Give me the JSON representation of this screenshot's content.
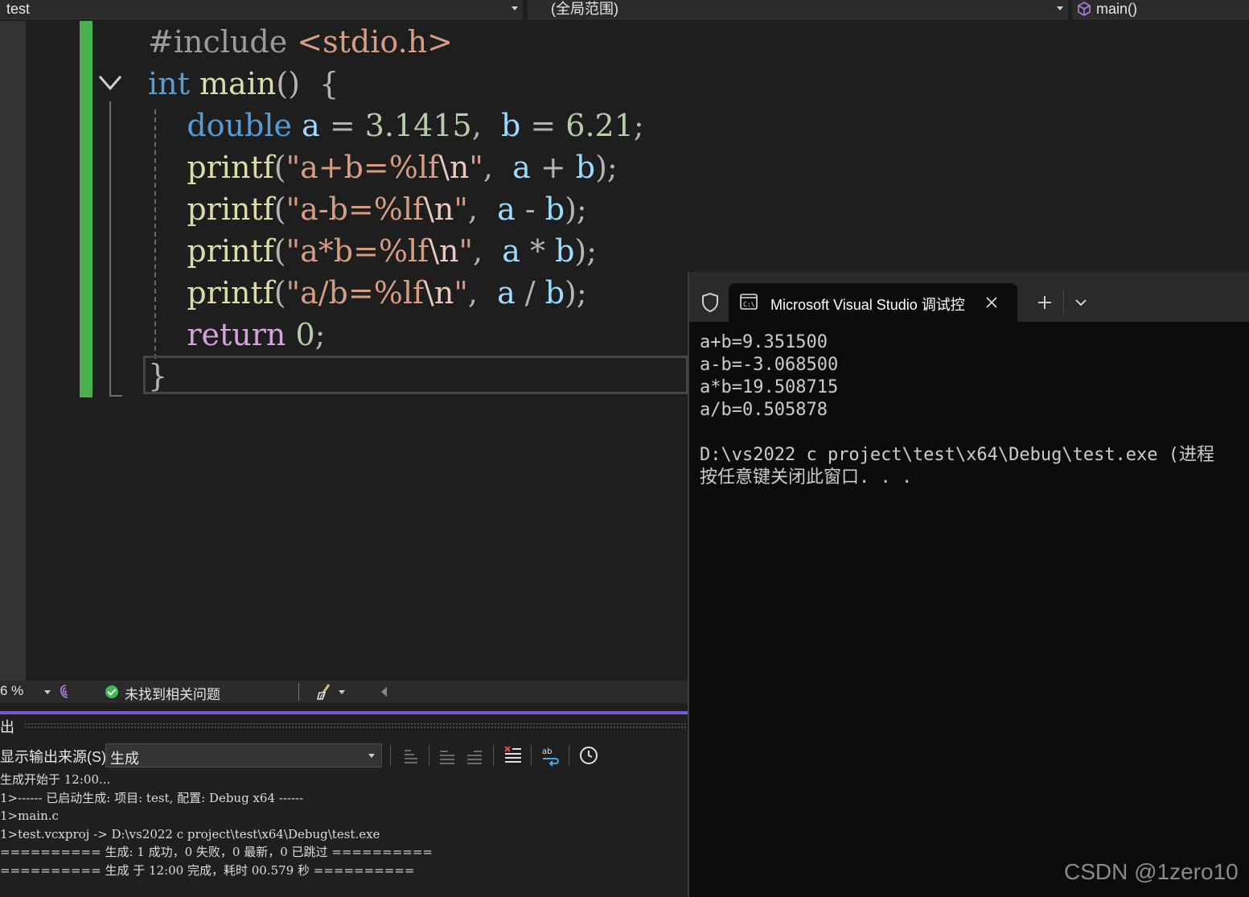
{
  "navbar": {
    "project": "test",
    "scope": "(全局范围)",
    "member": "main()"
  },
  "editor": {
    "lines": [
      {
        "tokens": [
          {
            "t": "#include ",
            "c": "pre"
          },
          {
            "t": "<stdio.h>",
            "c": "inc"
          }
        ]
      },
      {
        "tokens": [
          {
            "t": "int",
            "c": "kw"
          },
          {
            "t": " ",
            "c": ""
          },
          {
            "t": "main",
            "c": "fn"
          },
          {
            "t": "()  {",
            "c": "op"
          }
        ]
      },
      {
        "tokens": [
          {
            "t": "    ",
            "c": ""
          },
          {
            "t": "double",
            "c": "kw"
          },
          {
            "t": " ",
            "c": ""
          },
          {
            "t": "a",
            "c": "var"
          },
          {
            "t": " = ",
            "c": "op"
          },
          {
            "t": "3.1415",
            "c": "num"
          },
          {
            "t": ",  ",
            "c": "op"
          },
          {
            "t": "b",
            "c": "var"
          },
          {
            "t": " = ",
            "c": "op"
          },
          {
            "t": "6.21",
            "c": "num"
          },
          {
            "t": ";",
            "c": "op"
          }
        ]
      },
      {
        "tokens": [
          {
            "t": "    ",
            "c": ""
          },
          {
            "t": "printf",
            "c": "fn"
          },
          {
            "t": "(",
            "c": "op"
          },
          {
            "t": "\"a+b=%lf",
            "c": "str"
          },
          {
            "t": "\\n",
            "c": "esc"
          },
          {
            "t": "\"",
            "c": "str"
          },
          {
            "t": ",  ",
            "c": "op"
          },
          {
            "t": "a",
            "c": "var"
          },
          {
            "t": " + ",
            "c": "op"
          },
          {
            "t": "b",
            "c": "var"
          },
          {
            "t": ");",
            "c": "op"
          }
        ]
      },
      {
        "tokens": [
          {
            "t": "    ",
            "c": ""
          },
          {
            "t": "printf",
            "c": "fn"
          },
          {
            "t": "(",
            "c": "op"
          },
          {
            "t": "\"a-b=%lf",
            "c": "str"
          },
          {
            "t": "\\n",
            "c": "esc"
          },
          {
            "t": "\"",
            "c": "str"
          },
          {
            "t": ",  ",
            "c": "op"
          },
          {
            "t": "a",
            "c": "var"
          },
          {
            "t": " - ",
            "c": "op"
          },
          {
            "t": "b",
            "c": "var"
          },
          {
            "t": ");",
            "c": "op"
          }
        ]
      },
      {
        "tokens": [
          {
            "t": "    ",
            "c": ""
          },
          {
            "t": "printf",
            "c": "fn"
          },
          {
            "t": "(",
            "c": "op"
          },
          {
            "t": "\"a*b=%lf",
            "c": "str"
          },
          {
            "t": "\\n",
            "c": "esc"
          },
          {
            "t": "\"",
            "c": "str"
          },
          {
            "t": ",  ",
            "c": "op"
          },
          {
            "t": "a",
            "c": "var"
          },
          {
            "t": " * ",
            "c": "op"
          },
          {
            "t": "b",
            "c": "var"
          },
          {
            "t": ");",
            "c": "op"
          }
        ]
      },
      {
        "tokens": [
          {
            "t": "    ",
            "c": ""
          },
          {
            "t": "printf",
            "c": "fn"
          },
          {
            "t": "(",
            "c": "op"
          },
          {
            "t": "\"a/b=%lf",
            "c": "str"
          },
          {
            "t": "\\n",
            "c": "esc"
          },
          {
            "t": "\"",
            "c": "str"
          },
          {
            "t": ",  ",
            "c": "op"
          },
          {
            "t": "a",
            "c": "var"
          },
          {
            "t": " / ",
            "c": "op"
          },
          {
            "t": "b",
            "c": "var"
          },
          {
            "t": ");",
            "c": "op"
          }
        ]
      },
      {
        "tokens": [
          {
            "t": "    ",
            "c": ""
          },
          {
            "t": "return",
            "c": "ret"
          },
          {
            "t": " ",
            "c": ""
          },
          {
            "t": "0",
            "c": "num"
          },
          {
            "t": ";",
            "c": "op"
          }
        ]
      },
      {
        "tokens": [
          {
            "t": "}",
            "c": "op"
          }
        ]
      }
    ]
  },
  "status": {
    "zoom": "6 %",
    "issues": "未找到相关问题"
  },
  "output": {
    "title": "出",
    "source_label": "显示输出来源(S):",
    "source_value": "生成",
    "lines": [
      "生成开始于 12:00...",
      "1>------ 已启动生成: 项目: test, 配置: Debug x64 ------",
      "1>main.c",
      "1>test.vcxproj -> D:\\vs2022 c project\\test\\x64\\Debug\\test.exe",
      "========== 生成: 1 成功，0 失败，0 最新，0 已跳过 ==========",
      "========== 生成 于 12:00 完成，耗时 00.579 秒 =========="
    ]
  },
  "console": {
    "tab_title": "Microsoft Visual Studio 调试控",
    "lines": [
      "a+b=9.351500",
      "a-b=-3.068500",
      "a*b=19.508715",
      "a/b=0.505878",
      "",
      "D:\\vs2022 c project\\test\\x64\\Debug\\test.exe (进程",
      "按任意键关闭此窗口. . ."
    ]
  },
  "watermark": "CSDN @1zero10"
}
